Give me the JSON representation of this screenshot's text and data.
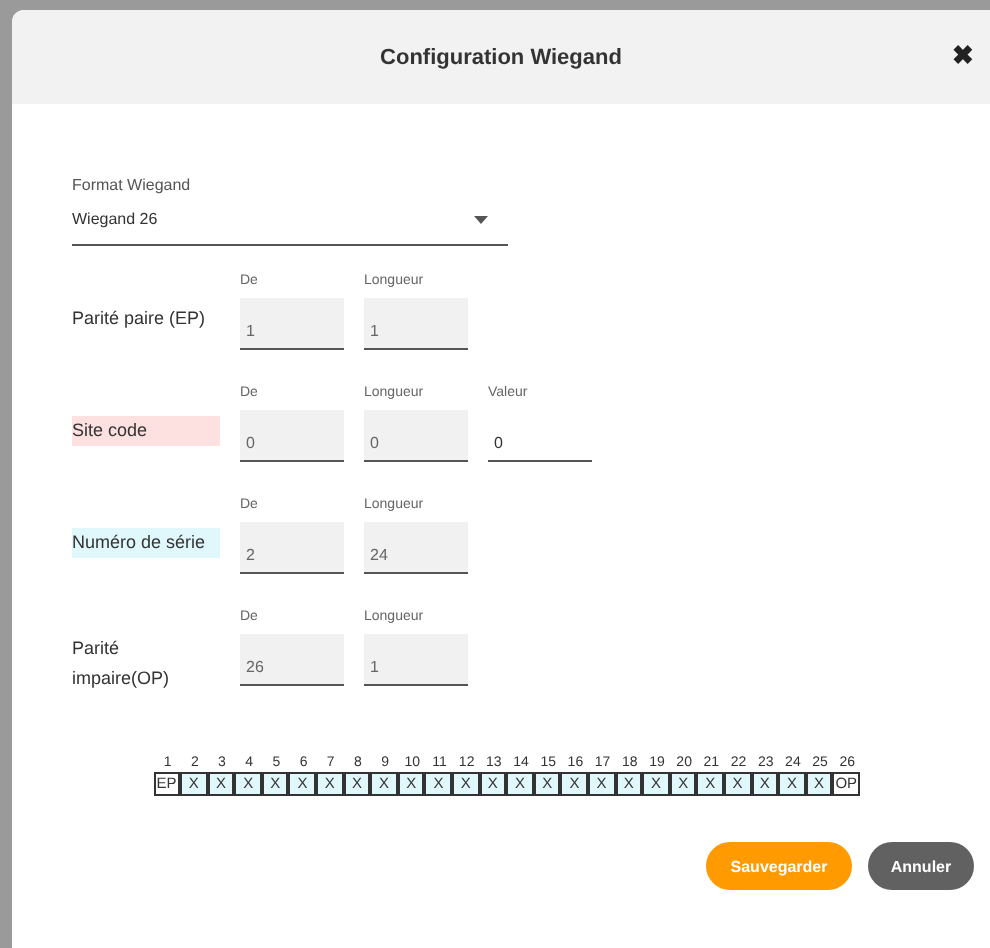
{
  "dialog": {
    "title": "Configuration Wiegand",
    "close": "✖"
  },
  "format": {
    "label": "Format Wiegand",
    "value": "Wiegand 26"
  },
  "rows": [
    {
      "label": "Parité paire (EP)",
      "fields": [
        {
          "label": "De",
          "value": "1",
          "disabled": true
        },
        {
          "label": "Longueur",
          "value": "1",
          "disabled": true
        }
      ]
    },
    {
      "label": "Site code",
      "color": "#fde0e0",
      "fields": [
        {
          "label": "De",
          "value": "0",
          "disabled": true
        },
        {
          "label": "Longueur",
          "value": "0",
          "disabled": true
        },
        {
          "label": "Valeur",
          "value": "0",
          "disabled": false
        }
      ]
    },
    {
      "label": "Numéro de série",
      "color": "#e0f7fb",
      "fields": [
        {
          "label": "De",
          "value": "2",
          "disabled": true
        },
        {
          "label": "Longueur",
          "value": "24",
          "disabled": true
        }
      ]
    },
    {
      "label": "Parité impaire(OP)",
      "fields": [
        {
          "label": "De",
          "value": "26",
          "disabled": true
        },
        {
          "label": "Longueur",
          "value": "1",
          "disabled": true
        }
      ]
    }
  ],
  "bits": [
    {
      "index": "1",
      "text": "EP",
      "color": "#ffffff"
    },
    {
      "index": "2",
      "text": "X",
      "color": "#e0f7fb"
    },
    {
      "index": "3",
      "text": "X",
      "color": "#e0f7fb"
    },
    {
      "index": "4",
      "text": "X",
      "color": "#e0f7fb"
    },
    {
      "index": "5",
      "text": "X",
      "color": "#e0f7fb"
    },
    {
      "index": "6",
      "text": "X",
      "color": "#e0f7fb"
    },
    {
      "index": "7",
      "text": "X",
      "color": "#e0f7fb"
    },
    {
      "index": "8",
      "text": "X",
      "color": "#e0f7fb"
    },
    {
      "index": "9",
      "text": "X",
      "color": "#e0f7fb"
    },
    {
      "index": "10",
      "text": "X",
      "color": "#e0f7fb"
    },
    {
      "index": "11",
      "text": "X",
      "color": "#e0f7fb"
    },
    {
      "index": "12",
      "text": "X",
      "color": "#e0f7fb"
    },
    {
      "index": "13",
      "text": "X",
      "color": "#e0f7fb"
    },
    {
      "index": "14",
      "text": "X",
      "color": "#e0f7fb"
    },
    {
      "index": "15",
      "text": "X",
      "color": "#e0f7fb"
    },
    {
      "index": "16",
      "text": "X",
      "color": "#e0f7fb"
    },
    {
      "index": "17",
      "text": "X",
      "color": "#e0f7fb"
    },
    {
      "index": "18",
      "text": "X",
      "color": "#e0f7fb"
    },
    {
      "index": "19",
      "text": "X",
      "color": "#e0f7fb"
    },
    {
      "index": "20",
      "text": "X",
      "color": "#e0f7fb"
    },
    {
      "index": "21",
      "text": "X",
      "color": "#e0f7fb"
    },
    {
      "index": "22",
      "text": "X",
      "color": "#e0f7fb"
    },
    {
      "index": "23",
      "text": "X",
      "color": "#e0f7fb"
    },
    {
      "index": "24",
      "text": "X",
      "color": "#e0f7fb"
    },
    {
      "index": "25",
      "text": "X",
      "color": "#e0f7fb"
    },
    {
      "index": "26",
      "text": "OP",
      "color": "#ffffff"
    }
  ],
  "buttons": [
    {
      "label": "Sauvegarder",
      "kind": "primary"
    },
    {
      "label": "Annuler",
      "kind": "secondary"
    }
  ]
}
